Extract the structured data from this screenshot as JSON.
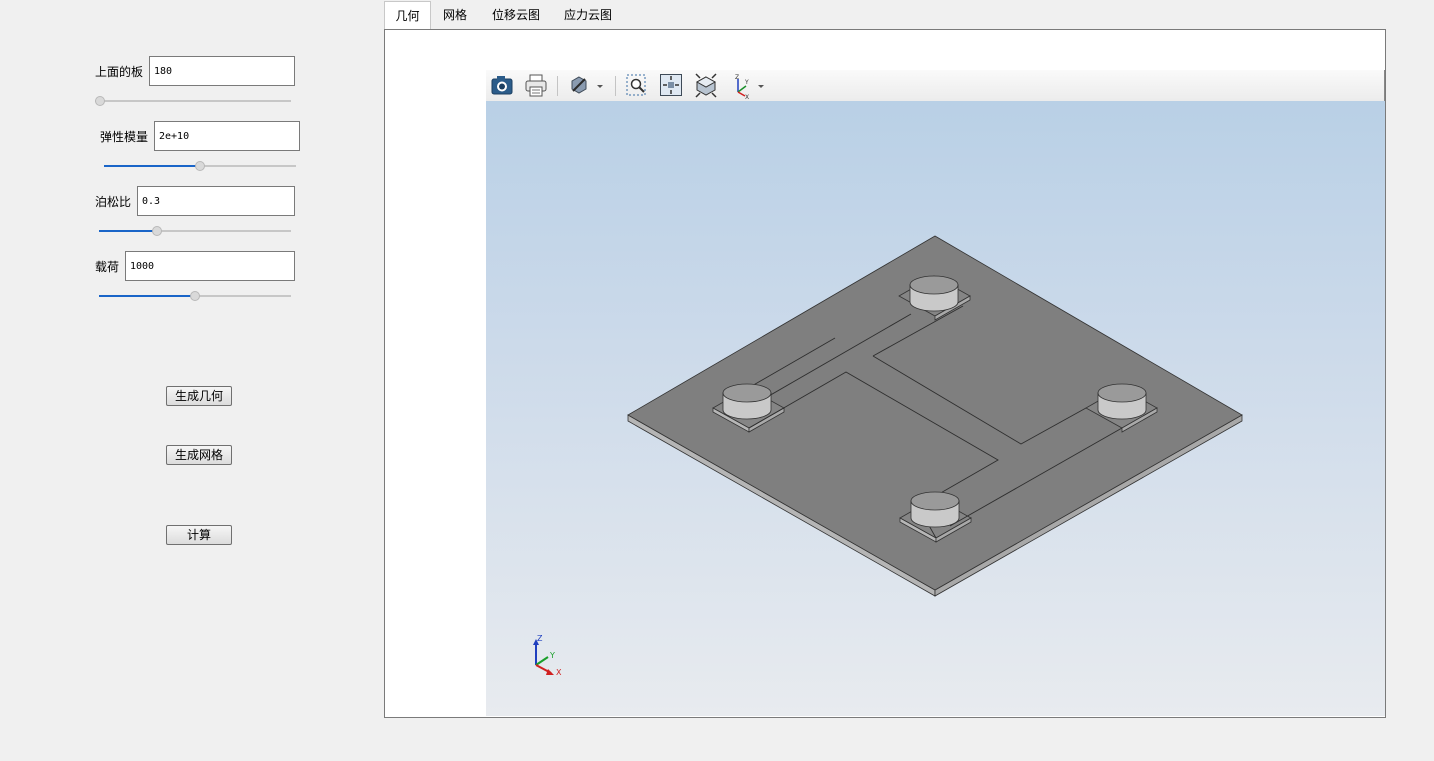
{
  "params": [
    {
      "label": "上面的板",
      "value": "180"
    },
    {
      "label": "弹性模量",
      "value": "2e+10"
    },
    {
      "label": "泊松比",
      "value": "0.3"
    },
    {
      "label": "载荷",
      "value": "1000"
    }
  ],
  "sliders": {
    "s0": 0.0,
    "s1": 0.5,
    "s2": 0.3,
    "s3": 0.5
  },
  "buttons": {
    "gen_geometry": "生成几何",
    "gen_mesh": "生成网格",
    "compute": "计算"
  },
  "tabs": [
    {
      "label": "几何"
    },
    {
      "label": "网格"
    },
    {
      "label": "位移云图"
    },
    {
      "label": "应力云图"
    }
  ],
  "toolbar": [
    "camera-icon",
    "print-icon",
    "clip-plane-icon",
    "zoom-box-icon",
    "fit-all-icon",
    "iso-view-icon",
    "axes-view-icon"
  ],
  "axes": {
    "z": "Z",
    "y": "Y",
    "x": "X"
  },
  "colors": {
    "accent": "#1a65c8",
    "model": "#808080",
    "plate_top": "#7f7f7f",
    "plate_edge": "#b5b5b5"
  }
}
